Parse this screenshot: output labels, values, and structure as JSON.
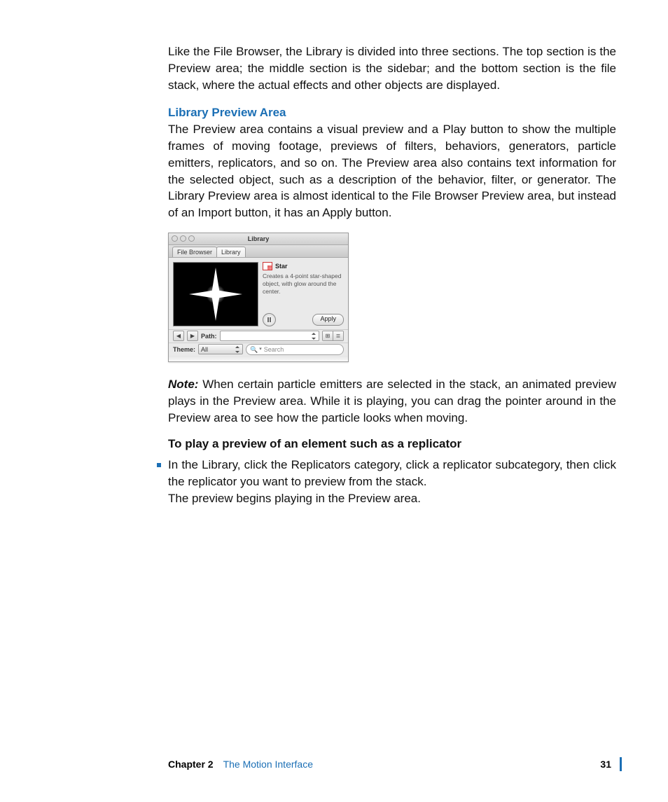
{
  "body": {
    "intro": "Like the File Browser, the Library is divided into three sections. The top section is the Preview area; the middle section is the sidebar; and the bottom section is the file stack, where the actual effects and other objects are displayed.",
    "heading": "Library Preview Area",
    "heading_para": "The Preview area contains a visual preview and a Play button to show the multiple frames of moving footage, previews of filters, behaviors, generators, particle emitters, replicators, and so on. The Preview area also contains text information for the selected object, such as a description of the behavior, filter, or generator. The Library Preview area is almost identical to the File Browser Preview area, but instead of an Import button, it has an Apply button.",
    "note_label": "Note:",
    "note_text": "  When certain particle emitters are selected in the stack, an animated preview plays in the Preview area. While it is playing, you can drag the pointer around in the Preview area to see how the particle looks when moving.",
    "task_heading": "To play a preview of an element such as a replicator",
    "bullet": "In the Library, click the Replicators category, click a replicator subcategory, then click the replicator you want to preview from the stack.",
    "result": "The preview begins playing in the Preview area."
  },
  "shot": {
    "window_title": "Library",
    "tabs": {
      "file_browser": "File Browser",
      "library": "Library"
    },
    "item_name": "Star",
    "item_desc": "Creates a 4-point star-shaped object, with glow around the center.",
    "apply": "Apply",
    "path_label": "Path:",
    "theme_label": "Theme:",
    "theme_value": "All",
    "search_placeholder": "Search",
    "nav_prev": "◀",
    "nav_next": "▶",
    "view_grid": "⊞",
    "view_list": "≣",
    "search_icon": "🔍"
  },
  "footer": {
    "chapter": "Chapter 2",
    "title": "The Motion Interface",
    "page": "31"
  }
}
